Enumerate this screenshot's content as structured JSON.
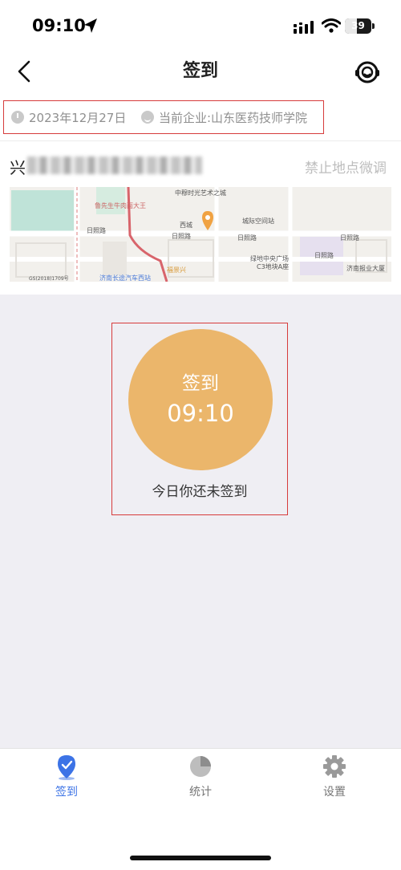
{
  "status_bar": {
    "time": "09:10",
    "battery": "39"
  },
  "nav": {
    "title": "签到"
  },
  "info": {
    "date": "2023年12月27日",
    "enterprise": "当前企业:山东医药技师学院"
  },
  "address": {
    "prefix": "兴",
    "action": "禁止地点微调"
  },
  "map": {
    "labels": [
      "中穆时光艺术之城",
      "鲁先生牛肉面大王",
      "日照路",
      "日照路",
      "日照路",
      "日照路",
      "西城",
      "城际空间站",
      "绿地中央广场",
      "C3地块A座",
      "济南报业大厦",
      "济南长途汽车西站",
      "福景兴",
      "日照路",
      "GS(2018)1709号"
    ]
  },
  "checkin": {
    "label": "签到",
    "time": "09:10",
    "status": "今日你还未签到"
  },
  "tabs": [
    {
      "label": "签到",
      "icon": "checkin-pin-icon",
      "active": true
    },
    {
      "label": "统计",
      "icon": "pie-chart-icon",
      "active": false
    },
    {
      "label": "设置",
      "icon": "gear-icon",
      "active": false
    }
  ],
  "colors": {
    "accent": "#3c73e6",
    "checkin": "#ebb66b",
    "highlight_border": "#d63b3b"
  }
}
